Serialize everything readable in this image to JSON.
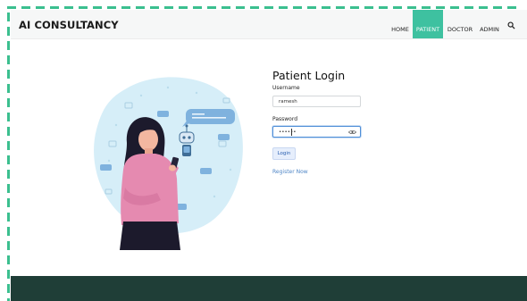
{
  "brand": {
    "name": "AI CONSULTANCY"
  },
  "nav": {
    "items": [
      {
        "label": "HOME",
        "active": false
      },
      {
        "label": "PATIENT",
        "active": true
      },
      {
        "label": "DOCTOR",
        "active": false
      },
      {
        "label": "ADMIN",
        "active": false
      }
    ],
    "search_icon": "search-icon"
  },
  "login": {
    "title": "Patient Login",
    "username_label": "Username",
    "username_value": "ramesh",
    "password_label": "Password",
    "password_value": "••••••",
    "login_button": "Login",
    "register_link": "Register Now"
  },
  "colors": {
    "accent": "#3ec1a0",
    "footer": "#1f3e37",
    "link": "#4f86c6",
    "frame_dash": "#3bbf8f"
  }
}
